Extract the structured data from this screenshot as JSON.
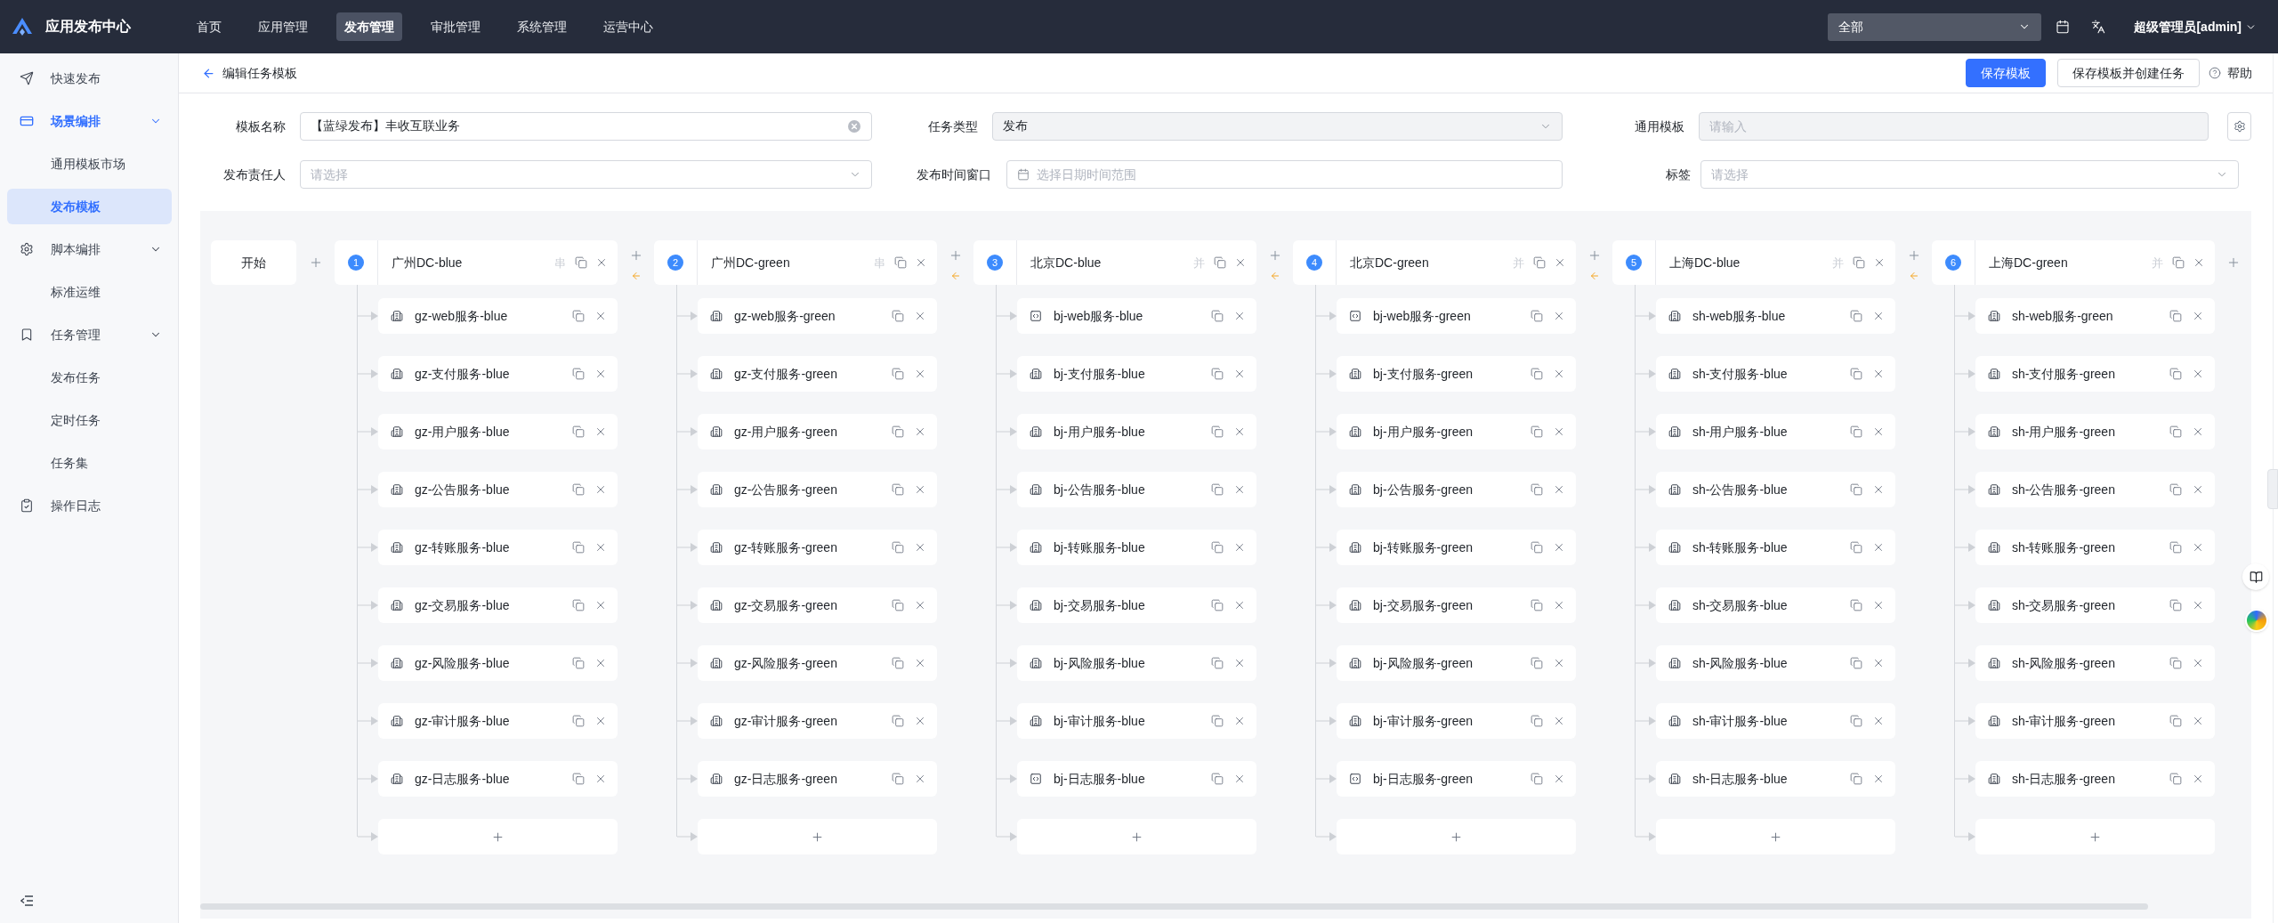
{
  "app": {
    "title": "应用发布中心"
  },
  "nav": [
    {
      "label": "首页",
      "selected": false
    },
    {
      "label": "应用管理",
      "selected": false
    },
    {
      "label": "发布管理",
      "selected": true
    },
    {
      "label": "审批管理",
      "selected": false
    },
    {
      "label": "系统管理",
      "selected": false
    },
    {
      "label": "运营中心",
      "selected": false
    }
  ],
  "toolbar": {
    "scope_select": {
      "value": "全部"
    },
    "user": "超级管理员[admin]"
  },
  "sidebar": {
    "items": [
      {
        "label": "快速发布",
        "selected": false
      },
      {
        "label": "场景编排",
        "selected": false,
        "expanded": true,
        "children": [
          {
            "label": "通用模板市场",
            "selected": false
          },
          {
            "label": "发布模板",
            "selected": true
          }
        ]
      },
      {
        "label": "脚本编排",
        "selected": false,
        "expanded": true,
        "children": [
          {
            "label": "标准运维",
            "selected": false
          }
        ]
      },
      {
        "label": "任务管理",
        "selected": false,
        "expanded": true,
        "children": [
          {
            "label": "发布任务",
            "selected": false
          },
          {
            "label": "定时任务",
            "selected": false
          },
          {
            "label": "任务集",
            "selected": false
          }
        ]
      },
      {
        "label": "操作日志",
        "selected": false
      }
    ]
  },
  "page_header": {
    "title": "编辑任务模板",
    "buttons": [
      {
        "label": "保存模板",
        "kind": "primary"
      },
      {
        "label": "保存模板并创建任务",
        "kind": "default"
      }
    ],
    "help": "帮助"
  },
  "form": {
    "fields": [
      {
        "label": "模板名称",
        "kind": "text",
        "value": "【蓝绿发布】丰收互联业务",
        "clearable": true,
        "disabled": false
      },
      {
        "label": "任务类型",
        "kind": "select",
        "value": "发布",
        "disabled": true
      },
      {
        "label": "通用模板",
        "kind": "text",
        "placeholder": "请输入",
        "disabled": true
      },
      {
        "label": "发布责任人",
        "kind": "select",
        "placeholder": "请选择",
        "disabled": false
      },
      {
        "label": "发布时间窗口",
        "kind": "daterange",
        "placeholder": "选择日期时间范围",
        "disabled": false
      },
      {
        "label": "标签",
        "kind": "select",
        "placeholder": "请选择",
        "disabled": false
      }
    ]
  },
  "flow": {
    "start": "开始",
    "stages": [
      {
        "number": "1",
        "title": "广州DC-blue",
        "mode": "串",
        "services": [
          {
            "name": "gz-web服务-blue",
            "kind": "app"
          },
          {
            "name": "gz-支付服务-blue",
            "kind": "app"
          },
          {
            "name": "gz-用户服务-blue",
            "kind": "app"
          },
          {
            "name": "gz-公告服务-blue",
            "kind": "app"
          },
          {
            "name": "gz-转账服务-blue",
            "kind": "app"
          },
          {
            "name": "gz-交易服务-blue",
            "kind": "app"
          },
          {
            "name": "gz-风险服务-blue",
            "kind": "app"
          },
          {
            "name": "gz-审计服务-blue",
            "kind": "app"
          },
          {
            "name": "gz-日志服务-blue",
            "kind": "app"
          }
        ]
      },
      {
        "number": "2",
        "title": "广州DC-green",
        "mode": "串",
        "services": [
          {
            "name": "gz-web服务-green",
            "kind": "app"
          },
          {
            "name": "gz-支付服务-green",
            "kind": "app"
          },
          {
            "name": "gz-用户服务-green",
            "kind": "app"
          },
          {
            "name": "gz-公告服务-green",
            "kind": "app"
          },
          {
            "name": "gz-转账服务-green",
            "kind": "app"
          },
          {
            "name": "gz-交易服务-green",
            "kind": "app"
          },
          {
            "name": "gz-风险服务-green",
            "kind": "app"
          },
          {
            "name": "gz-审计服务-green",
            "kind": "app"
          },
          {
            "name": "gz-日志服务-green",
            "kind": "app"
          }
        ]
      },
      {
        "number": "3",
        "title": "北京DC-blue",
        "mode": "并",
        "services": [
          {
            "name": "bj-web服务-blue",
            "kind": "code"
          },
          {
            "name": "bj-支付服务-blue",
            "kind": "app"
          },
          {
            "name": "bj-用户服务-blue",
            "kind": "app"
          },
          {
            "name": "bj-公告服务-blue",
            "kind": "app"
          },
          {
            "name": "bj-转账服务-blue",
            "kind": "app"
          },
          {
            "name": "bj-交易服务-blue",
            "kind": "app"
          },
          {
            "name": "bj-风险服务-blue",
            "kind": "app"
          },
          {
            "name": "bj-审计服务-blue",
            "kind": "app"
          },
          {
            "name": "bj-日志服务-blue",
            "kind": "code"
          }
        ]
      },
      {
        "number": "4",
        "title": "北京DC-green",
        "mode": "并",
        "services": [
          {
            "name": "bj-web服务-green",
            "kind": "code"
          },
          {
            "name": "bj-支付服务-green",
            "kind": "app"
          },
          {
            "name": "bj-用户服务-green",
            "kind": "app"
          },
          {
            "name": "bj-公告服务-green",
            "kind": "app"
          },
          {
            "name": "bj-转账服务-green",
            "kind": "app"
          },
          {
            "name": "bj-交易服务-green",
            "kind": "app"
          },
          {
            "name": "bj-风险服务-green",
            "kind": "app"
          },
          {
            "name": "bj-审计服务-green",
            "kind": "app"
          },
          {
            "name": "bj-日志服务-green",
            "kind": "code"
          }
        ]
      },
      {
        "number": "5",
        "title": "上海DC-blue",
        "mode": "并",
        "services": [
          {
            "name": "sh-web服务-blue",
            "kind": "app"
          },
          {
            "name": "sh-支付服务-blue",
            "kind": "app"
          },
          {
            "name": "sh-用户服务-blue",
            "kind": "app"
          },
          {
            "name": "sh-公告服务-blue",
            "kind": "app"
          },
          {
            "name": "sh-转账服务-blue",
            "kind": "app"
          },
          {
            "name": "sh-交易服务-blue",
            "kind": "app"
          },
          {
            "name": "sh-风险服务-blue",
            "kind": "app"
          },
          {
            "name": "sh-审计服务-blue",
            "kind": "app"
          },
          {
            "name": "sh-日志服务-blue",
            "kind": "app"
          }
        ]
      },
      {
        "number": "6",
        "title": "上海DC-green",
        "mode": "并",
        "services": [
          {
            "name": "sh-web服务-green",
            "kind": "app"
          },
          {
            "name": "sh-支付服务-green",
            "kind": "app"
          },
          {
            "name": "sh-用户服务-green",
            "kind": "app"
          },
          {
            "name": "sh-公告服务-green",
            "kind": "app"
          },
          {
            "name": "sh-转账服务-green",
            "kind": "app"
          },
          {
            "name": "sh-交易服务-green",
            "kind": "app"
          },
          {
            "name": "sh-风险服务-green",
            "kind": "app"
          },
          {
            "name": "sh-审计服务-green",
            "kind": "app"
          },
          {
            "name": "sh-日志服务-green",
            "kind": "app"
          }
        ]
      }
    ]
  }
}
